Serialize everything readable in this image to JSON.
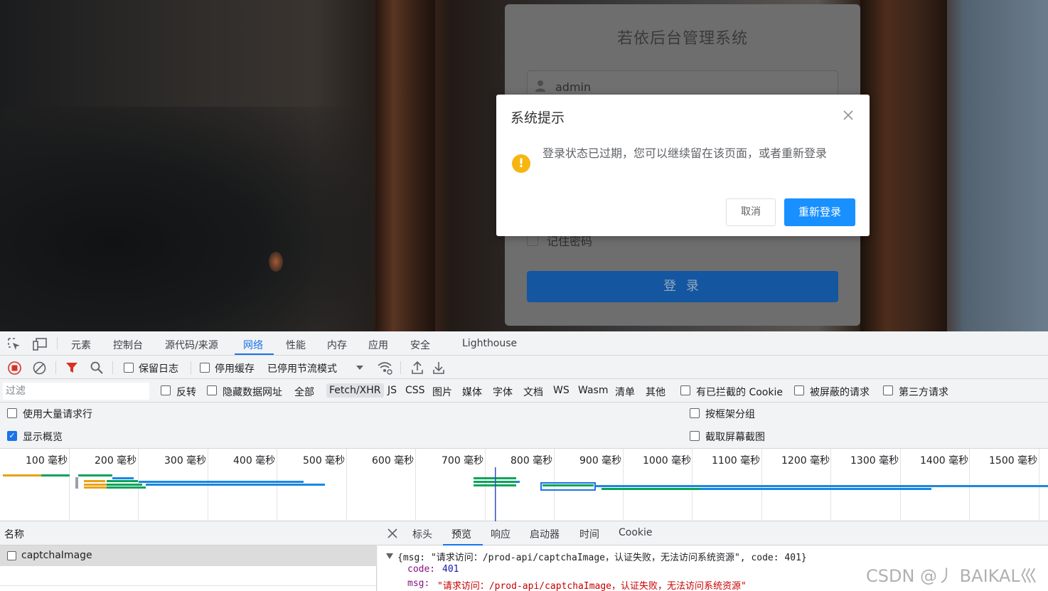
{
  "login_page": {
    "title": "若依后台管理系统",
    "username_value": "admin",
    "remember_label": "记住密码",
    "login_button": "登 录"
  },
  "modal": {
    "title": "系统提示",
    "message": "登录状态已过期，您可以继续留在该页面，或者重新登录",
    "cancel_label": "取消",
    "confirm_label": "重新登录",
    "warning_glyph": "!"
  },
  "devtools": {
    "tabs": [
      "元素",
      "控制台",
      "源代码/来源",
      "网络",
      "性能",
      "内存",
      "应用",
      "安全",
      "Lighthouse"
    ],
    "active_tab": "网络",
    "toolbar": {
      "preserve_log": "保留日志",
      "disable_cache": "停用缓存",
      "throttling": "已停用节流模式"
    },
    "filter": {
      "placeholder": "过滤",
      "invert": "反转",
      "hide_data_urls": "隐藏数据网址",
      "types": [
        "全部",
        "Fetch/XHR",
        "JS",
        "CSS",
        "图片",
        "媒体",
        "字体",
        "文档",
        "WS",
        "Wasm",
        "清单",
        "其他"
      ],
      "active_type": "Fetch/XHR",
      "blocked_cookies": "有已拦截的 Cookie",
      "blocked_requests": "被屏蔽的请求",
      "third_party": "第三方请求"
    },
    "options": {
      "large_rows": "使用大量请求行",
      "show_overview": "显示概览",
      "group_by_frame": "按框架分组",
      "capture_screenshots": "截取屏幕截图",
      "show_overview_checked": true
    },
    "timeline_ticks": [
      "100 毫秒",
      "200 毫秒",
      "300 毫秒",
      "400 毫秒",
      "500 毫秒",
      "600 毫秒",
      "700 毫秒",
      "800 毫秒",
      "900 毫秒",
      "1000 毫秒",
      "1100 毫秒",
      "1200 毫秒",
      "1300 毫秒",
      "1400 毫秒",
      "1500 毫秒"
    ],
    "names_header": "名称",
    "request_name": "captchaImage",
    "detail_tabs": [
      "标头",
      "预览",
      "响应",
      "启动器",
      "时间",
      "Cookie"
    ],
    "active_detail_tab": "预览",
    "preview": {
      "summary": "{msg: \"请求访问：/prod-api/captchaImage，认证失败，无法访问系统资源\", code: 401}",
      "code_key": "code:",
      "code_value": "401",
      "msg_key": "msg:",
      "msg_value": "\"请求访问：/prod-api/captchaImage，认证失败，无法访问系统资源\""
    },
    "colors": {
      "accent": "#1a73e8",
      "record": "#d93025",
      "code_blue": "#1a1aa6",
      "string_red": "#c80000",
      "key_purple": "#881280"
    }
  },
  "watermark": "CSDN @丿 BAIKAL巛"
}
